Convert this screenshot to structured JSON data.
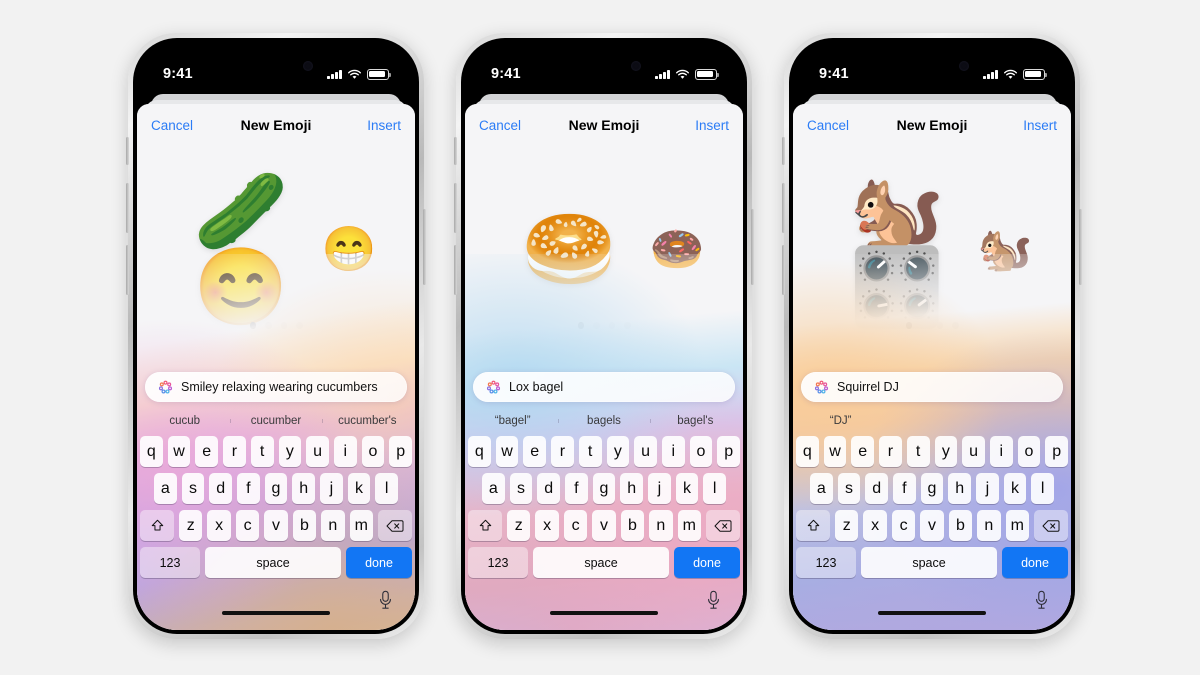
{
  "scene": {
    "background": "#f2f2f2",
    "accent_blue": "#2b7cf6",
    "done_key_blue": "#1276f4"
  },
  "status_bar": {
    "time": "9:41",
    "signal_icon": "cellular-signal-icon",
    "wifi_icon": "wifi-icon",
    "battery_icon": "battery-icon"
  },
  "navbar": {
    "cancel_label": "Cancel",
    "title": "New Emoji",
    "insert_label": "Insert"
  },
  "keyboard": {
    "row1": [
      "q",
      "w",
      "e",
      "r",
      "t",
      "y",
      "u",
      "i",
      "o",
      "p"
    ],
    "row2": [
      "a",
      "s",
      "d",
      "f",
      "g",
      "h",
      "j",
      "k",
      "l"
    ],
    "row3": [
      "z",
      "x",
      "c",
      "v",
      "b",
      "n",
      "m"
    ],
    "shift_icon": "shift-icon",
    "delete_icon": "delete-backward-icon",
    "numbers_label": "123",
    "space_label": "space",
    "done_label": "done",
    "mic_icon": "microphone-icon"
  },
  "phones": [
    {
      "id": "phone-cucumber",
      "prompt": "Smiley relaxing wearing cucumbers",
      "genmoji_icon": "genmoji-sparkle-icon",
      "emoji_main": "🥒😊",
      "emoji_next": "😁",
      "page_dots": 4,
      "page_active": 1,
      "suggestions": [
        "cucub",
        "cucumber",
        "cucumber's"
      ],
      "glow_css": "linear-gradient(170deg, rgba(245,245,247,0) 0%, rgba(245,245,247,0.96) 22%, rgba(250,226,200,0.85) 36%, rgba(225,175,225,0.95) 48%, rgba(196,160,232,0.97) 62%, rgba(178,160,228,0.95) 78%, rgba(214,178,146,0.95) 100%)",
      "glow_css2": "radial-gradient(120% 70% at 12% 58%, rgba(236,168,214,0.75) 0%, rgba(236,168,214,0) 58%), radial-gradient(110% 60% at 92% 40%, rgba(252,214,168,0.65) 0%, rgba(252,214,168,0) 60%), radial-gradient(130% 80% at 70% 100%, rgba(214,176,140,0.85) 0%, rgba(214,176,140,0) 60%)"
    },
    {
      "id": "phone-bagel",
      "prompt": "Lox bagel",
      "genmoji_icon": "genmoji-sparkle-icon",
      "emoji_main": "🥯",
      "emoji_next": "🍩",
      "page_dots": 4,
      "page_active": 1,
      "suggestions": [
        "“bagel”",
        "bagels",
        "bagel's"
      ],
      "glow_css": "linear-gradient(175deg, rgba(245,245,247,0) 0%, rgba(245,245,247,0.95) 20%, rgba(198,228,244,0.92) 34%, rgba(214,196,236,0.95) 48%, rgba(232,176,196,0.95) 66%, rgba(222,168,190,0.95) 84%, rgba(206,180,224,0.95) 100%)",
      "glow_css2": "radial-gradient(120% 65% at 18% 34%, rgba(172,214,240,0.80) 0%, rgba(172,214,240,0) 58%), radial-gradient(120% 70% at 88% 78%, rgba(238,170,196,0.78) 0%, rgba(238,170,196,0) 60%), radial-gradient(130% 70% at 40% 100%, rgba(226,166,190,0.70) 0%, rgba(226,166,190,0) 62%)"
    },
    {
      "id": "phone-squirrel",
      "prompt": "Squirrel DJ",
      "genmoji_icon": "genmoji-sparkle-icon",
      "emoji_main": "🐿️🎛️",
      "emoji_next": "🐿️",
      "page_dots": 4,
      "page_active": 1,
      "suggestions": [
        "“DJ”",
        "",
        ""
      ],
      "glow_css": "linear-gradient(175deg, rgba(245,245,247,0) 0%, rgba(245,245,247,0.95) 18%, rgba(248,210,164,0.90) 32%, rgba(240,196,160,0.92) 44%, rgba(186,190,226,0.94) 64%, rgba(160,172,226,0.95) 82%, rgba(176,164,222,0.95) 100%)",
      "glow_css2": "radial-gradient(110% 60% at 12% 36%, rgba(250,204,150,0.85) 0%, rgba(250,204,150,0) 58%), radial-gradient(120% 70% at 95% 62%, rgba(158,160,232,0.82) 0%, rgba(158,160,232,0) 60%), radial-gradient(130% 70% at 50% 100%, rgba(176,168,224,0.72) 0%, rgba(176,168,224,0) 62%)"
    }
  ]
}
